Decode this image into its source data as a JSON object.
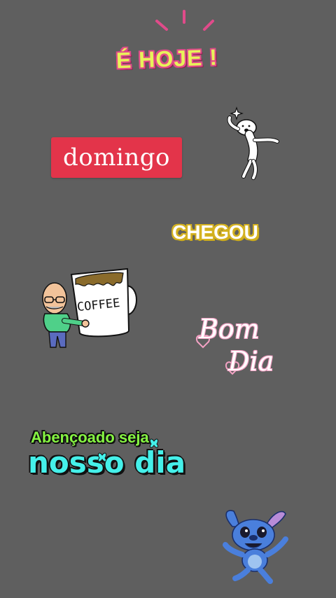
{
  "canvas": {
    "background": "#5f5f5f"
  },
  "stickers": {
    "hoje": {
      "text": "É HOJE !",
      "fill": "#e8f25a",
      "outline": "#e04b8a"
    },
    "domingo": {
      "text": "domingo",
      "background": "#e3344a"
    },
    "dancer": {
      "icon": "dancing-man-icon"
    },
    "chegou": {
      "text": "CHEGOU",
      "outline": "#d4b221"
    },
    "coffee": {
      "icon": "coffee-man-icon",
      "mug_text": "COFFEE"
    },
    "bom_dia": {
      "line1": "Bom",
      "line2": "Dia",
      "accent": "#f3a2c4"
    },
    "abencoado": {
      "line1": "Abençoado seja",
      "line2": "nosso dia",
      "line1_color": "#86f542",
      "line2_color": "#45f0ea"
    },
    "stitch": {
      "icon": "stitch-character-icon"
    }
  }
}
